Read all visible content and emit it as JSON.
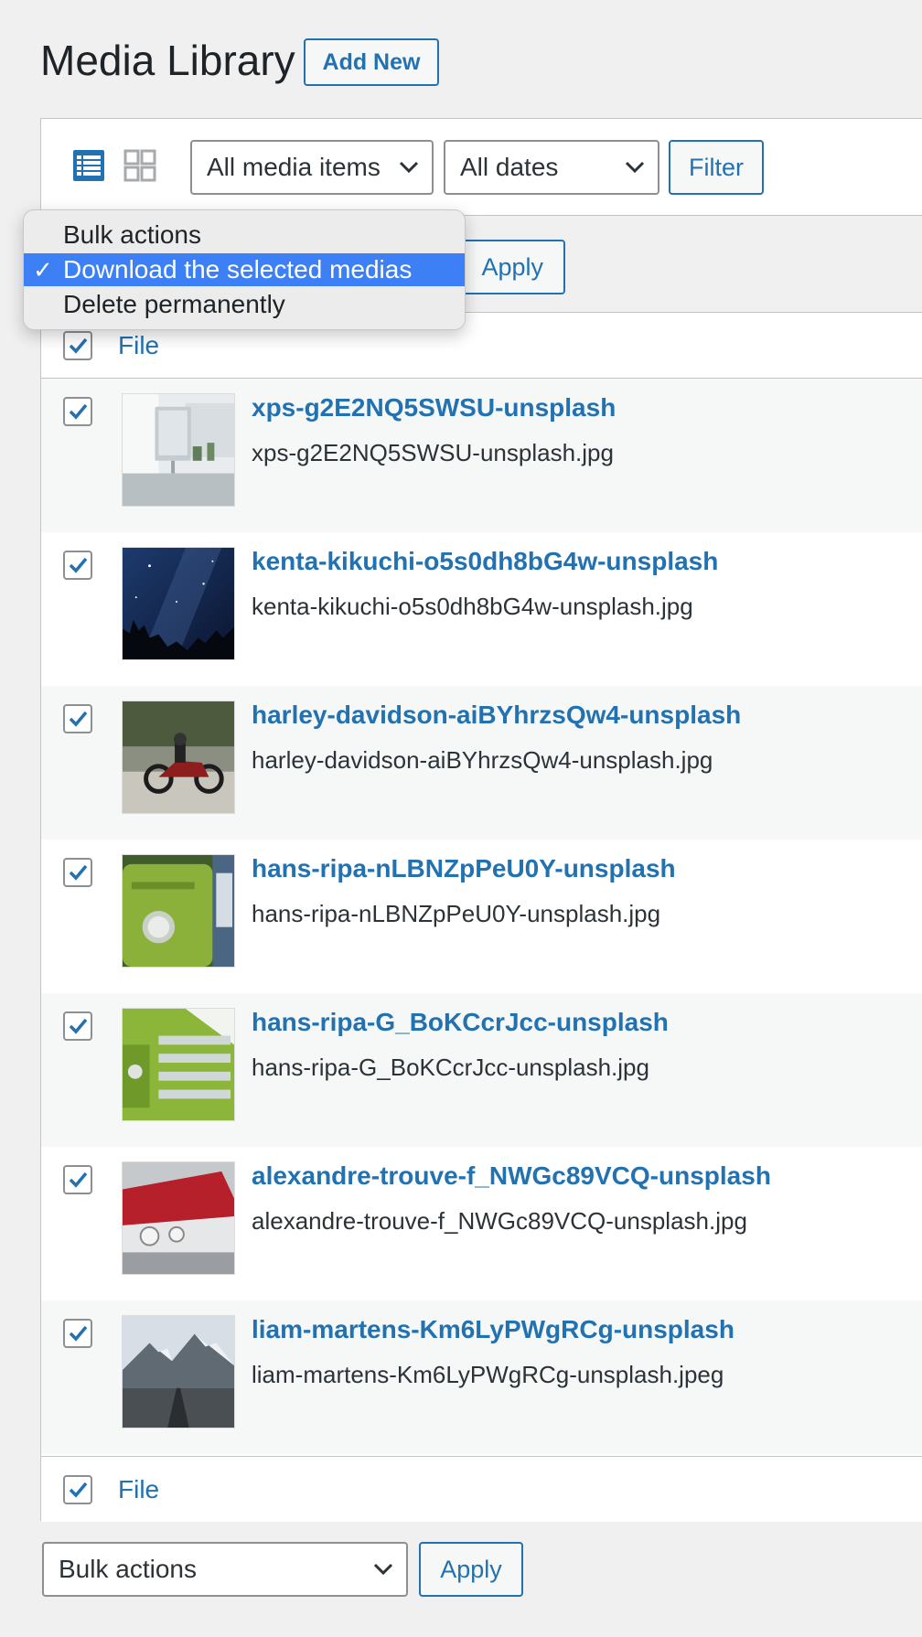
{
  "header": {
    "title": "Media Library",
    "add_new_label": "Add New"
  },
  "toolbar": {
    "view_modes": [
      "list-view-icon",
      "grid-view-icon"
    ],
    "active_view": "list",
    "media_type_filter": "All media items",
    "date_filter": "All dates",
    "filter_label": "Filter"
  },
  "bulk_top": {
    "apply_label": "Apply"
  },
  "bulk_dropdown": {
    "options": [
      {
        "label": "Bulk actions",
        "selected": false
      },
      {
        "label": "Download the selected medias",
        "selected": true
      },
      {
        "label": "Delete permanently",
        "selected": false
      }
    ],
    "check_mark": "✓"
  },
  "table": {
    "column_header": "File",
    "column_footer": "File",
    "rows": [
      {
        "title": "xps-g2E2NQ5SWSU-unsplash",
        "filename": "xps-g2E2NQ5SWSU-unsplash.jpg",
        "checked": true
      },
      {
        "title": "kenta-kikuchi-o5s0dh8bG4w-unsplash",
        "filename": "kenta-kikuchi-o5s0dh8bG4w-unsplash.jpg",
        "checked": true
      },
      {
        "title": "harley-davidson-aiBYhrzsQw4-unsplash",
        "filename": "harley-davidson-aiBYhrzsQw4-unsplash.jpg",
        "checked": true
      },
      {
        "title": "hans-ripa-nLBNZpPeU0Y-unsplash",
        "filename": "hans-ripa-nLBNZpPeU0Y-unsplash.jpg",
        "checked": true
      },
      {
        "title": "hans-ripa-G_BoKCcrJcc-unsplash",
        "filename": "hans-ripa-G_BoKCcrJcc-unsplash.jpg",
        "checked": true
      },
      {
        "title": "alexandre-trouve-f_NWGc89VCQ-unsplash",
        "filename": "alexandre-trouve-f_NWGc89VCQ-unsplash.jpg",
        "checked": true
      },
      {
        "title": "liam-martens-Km6LyPWgRCg-unsplash",
        "filename": "liam-martens-Km6LyPWgRCg-unsplash.jpeg",
        "checked": true
      }
    ]
  },
  "bulk_bottom": {
    "select_value": "Bulk actions",
    "apply_label": "Apply"
  },
  "colors": {
    "accent": "#2271b1",
    "dropdown_highlight": "#3d7ff5"
  }
}
